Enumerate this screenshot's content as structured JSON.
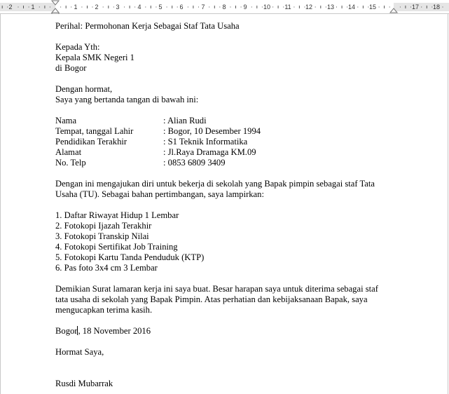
{
  "ruler": {
    "numbers": [
      "2",
      "1",
      "1",
      "2",
      "3",
      "4",
      "5",
      "6",
      "7",
      "8",
      "9",
      "10",
      "11",
      "12",
      "13",
      "14",
      "15",
      "17",
      "18"
    ]
  },
  "letter": {
    "subject": "Perihal: Permohonan Kerja Sebagai Staf Tata Usaha",
    "to_line1": "Kepada Yth:",
    "to_line2": "Kepala SMK Negeri 1",
    "to_line3": "di Bogor",
    "greeting": "Dengan hormat,",
    "intro": "Saya yang bertanda tangan di bawah ini:",
    "details": [
      {
        "label": "Nama",
        "value": ": Alian Rudi"
      },
      {
        "label": "Tempat, tanggal Lahir",
        "value": ": Bogor, 10 Desember 1994"
      },
      {
        "label": "Pendidikan Terakhir",
        "value": ": S1 Teknik Informatika"
      },
      {
        "label": "Alamat",
        "value": ": Jl.Raya Dramaga KM.09"
      },
      {
        "label": "No. Telp",
        "value": ": 0853 6809 3409"
      }
    ],
    "application_line1": "Dengan ini mengajukan diri untuk bekerja di sekolah yang Bapak pimpin sebagai staf Tata",
    "application_line2": "Usaha (TU). Sebagai bahan pertimbangan, saya lampirkan:",
    "attachments": [
      "1. Daftar Riwayat Hidup 1 Lembar",
      "2. Fotokopi Ijazah Terakhir",
      "3. Fotokopi Transkip Nilai",
      "4. Fotokopi Sertifikat Job Training",
      "5. Fotokopi Kartu Tanda Penduduk (KTP)",
      "6. Pas foto 3x4 cm 3 Lembar"
    ],
    "closing_line1": "Demikian Surat lamaran kerja ini saya buat. Besar harapan saya untuk diterima sebagai staf",
    "closing_line2": "tata usaha di sekolah yang Bapak Pimpin. Atas perhatian dan kebijaksanaan Bapak, saya",
    "closing_line3": "mengucapkan terima kasih.",
    "place": "Bogor",
    "date": ", 18 November 2016",
    "regards": "Hormat Saya,",
    "signer": "Rusdi Mubarrak"
  }
}
